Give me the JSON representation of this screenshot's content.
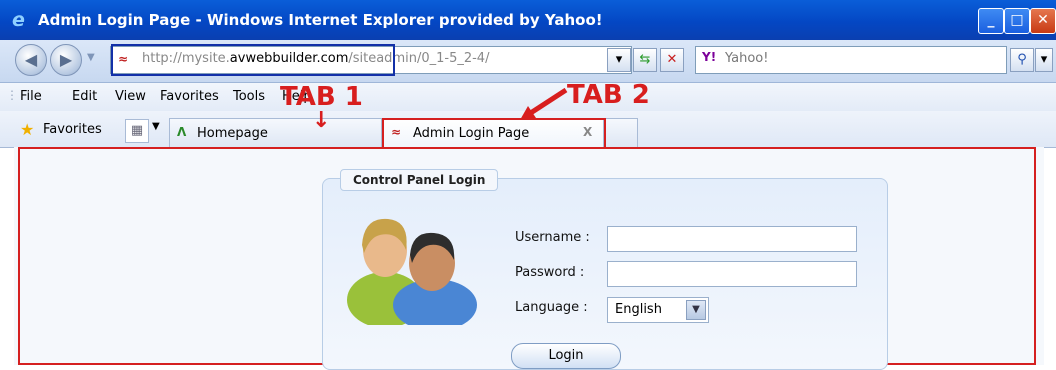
{
  "window": {
    "title": "Admin Login Page - Windows Internet Explorer provided by Yahoo!",
    "controls": {
      "minimize": "_",
      "maximize": "□",
      "close": "✕"
    }
  },
  "address_bar": {
    "url_prefix": "http://mysite.",
    "url_domain": "avwebbuilder.com",
    "url_path": "/siteadmin/0_1-5_2-4/",
    "search_placeholder": "Yahoo!"
  },
  "menu": {
    "items": [
      "File",
      "Edit",
      "View",
      "Favorites",
      "Tools",
      "Help"
    ]
  },
  "tabs": {
    "favorites_label": "Favorites",
    "items": [
      {
        "label": "Homepage"
      },
      {
        "label": "Admin Login Page"
      }
    ],
    "close_glyph": "X"
  },
  "annotations": {
    "tab1": "TAB 1",
    "tab2": "TAB 2"
  },
  "login_panel": {
    "title": "Control Panel Login",
    "username_label": "Username :",
    "password_label": "Password :",
    "language_label": "Language :",
    "language_value": "English",
    "login_button": "Login"
  }
}
